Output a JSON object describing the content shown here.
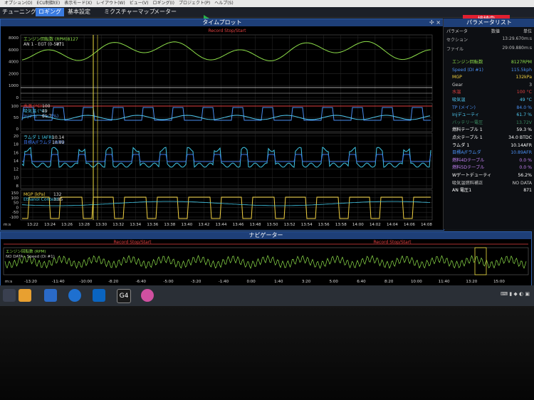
{
  "menu": [
    "オプション(O)",
    "ECU制御(E)",
    "表示モード(X)",
    "レイアウト(W)",
    "ビュー(V)",
    "ロギング(I)",
    "プロジェクト(P)",
    "ヘルプ(S)"
  ],
  "toolbar": {
    "tabs": [
      "チューニング",
      "ロギング",
      "基本設定",
      "ミクスチャーマップ",
      "メーター"
    ],
    "active_tab": "ロギング",
    "status": "接続中"
  },
  "time_plot": {
    "title": "タイムプロット",
    "record_label": "Record Stop/Start",
    "panel1": {
      "labels": [
        "エンジン回転数 (RPM)8127",
        "AN 1 - EGT (0-5V)"
      ],
      "readout": "871",
      "yticks": [
        "8000",
        "6000",
        "4000",
        "2000",
        "1000",
        "0"
      ]
    },
    "panel2": {
      "labels": [
        "水温 (°C)",
        "吸気温 (°C)",
        "Injデューティ (%)"
      ],
      "readouts": [
        "100",
        "49",
        "61.7"
      ],
      "yticks": [
        "100",
        "50",
        "0"
      ]
    },
    "panel3": {
      "labels": [
        "ラムダ 1 (AFR)",
        "目標A/Fラムダ (AFR)"
      ],
      "readouts": [
        "10.14",
        "10.89"
      ],
      "yticks": [
        "20",
        "18",
        "16",
        "14",
        "12",
        "10",
        "8"
      ]
    },
    "panel4": {
      "labels": [
        "MGP (kPa)",
        "Ethanol Content"
      ],
      "readouts": [
        "132",
        "3.85"
      ],
      "yticks": [
        "150",
        "100",
        "50",
        "0",
        "-50",
        "-100"
      ]
    },
    "axis_unit": "m:s",
    "x_ticks": [
      "13:22",
      "13:24",
      "13:26",
      "13:28",
      "13:30",
      "13:32",
      "13:34",
      "13:36",
      "13:38",
      "13:40",
      "13:42",
      "13:44",
      "13:46",
      "13:48",
      "13:50",
      "13:52",
      "13:54",
      "13:56",
      "13:58",
      "14:00",
      "14:02",
      "14:04",
      "14:06",
      "14:08"
    ],
    "colors": {
      "rpm": "#8ee04a",
      "coolant": "#e04040",
      "intake": "#4fc8f0",
      "inj": "#4a8ef0",
      "lambda": "#40c8e8",
      "target": "#3a70e0",
      "mgp": "#f0d040",
      "cursor": "#f0e040"
    }
  },
  "navigator": {
    "title": "ナビゲーター",
    "record_labels": [
      "Record Stop/Start",
      "Record Stop/Start"
    ],
    "labels": [
      "エンジン回転数 (RPM)",
      "NO DATA - Speed (Di #1)"
    ],
    "x_ticks": [
      "-13:20",
      "-11:40",
      "-10:00",
      "-8:20",
      "-6:40",
      "-5:00",
      "-3:20",
      "-1:40",
      "0:00",
      "1:40",
      "3:20",
      "5:00",
      "6:40",
      "8:20",
      "10:00",
      "11:40",
      "13:20",
      "15:00"
    ],
    "axis_unit": "m:s"
  },
  "params": {
    "title": "パラメータリスト",
    "head": [
      "パラメータ",
      "数値",
      "単位"
    ],
    "meta": [
      {
        "name": "セクション",
        "value": "13:29.670m:s"
      },
      {
        "name": "ファイル",
        "value": "29:09.880m:s"
      }
    ],
    "rows": [
      {
        "name": "エンジン回転数",
        "value": "8127RPM",
        "color": "#8ee04a"
      },
      {
        "name": "Speed (DI #1)",
        "value": "115.5kph",
        "color": "#4a8ef0"
      },
      {
        "name": "MGP",
        "value": "132kPa",
        "color": "#f0d040"
      },
      {
        "name": "Gear",
        "value": "3",
        "color": "#cccccc"
      },
      {
        "name": "水温",
        "value": "100 °C",
        "color": "#e04040"
      },
      {
        "name": "吸気温",
        "value": "49 °C",
        "color": "#4fc8f0"
      },
      {
        "name": "TP (メイン)",
        "value": "84.0 %",
        "color": "#4a8ef0"
      },
      {
        "name": "Injデューティ",
        "value": "61.7 %",
        "color": "#4fc8f0"
      },
      {
        "name": "バッテリー電圧",
        "value": "13.72V",
        "color": "#3a8a60"
      },
      {
        "name": "燃料テーブル 1",
        "value": "59.3 %",
        "color": "#ffffff"
      },
      {
        "name": "点火テーブル 1",
        "value": "34.0 BTDC",
        "color": "#ffffff"
      },
      {
        "name": "ラムダ 1",
        "value": "10.14AFR",
        "color": "#ffffff"
      },
      {
        "name": "目標A/Fラムダ",
        "value": "10.89AFR",
        "color": "#4a8ef0"
      },
      {
        "name": "燃料4Dテーブル",
        "value": "0.0 %",
        "color": "#c080f0"
      },
      {
        "name": "燃料5Dテーブル",
        "value": "0.0 %",
        "color": "#c080f0"
      },
      {
        "name": "Wゲートデューティ",
        "value": "56.2%",
        "color": "#ffffff"
      },
      {
        "name": "吸気温燃料補正",
        "value": "NO DATA",
        "color": "#cccccc"
      },
      {
        "name": "AN 電圧1",
        "value": "871",
        "color": "#ffffff"
      }
    ]
  }
}
